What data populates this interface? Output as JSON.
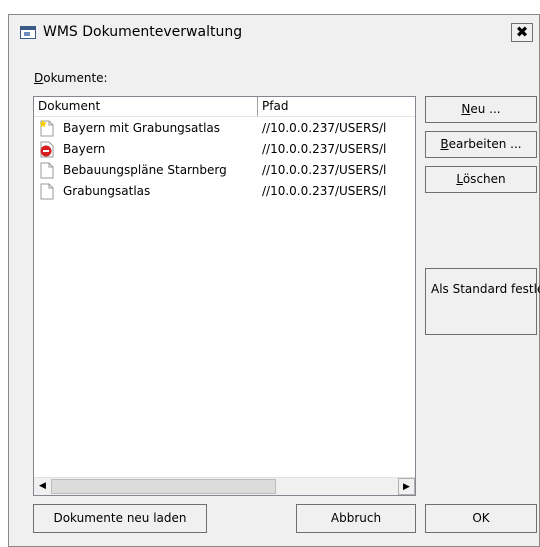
{
  "window": {
    "title": "WMS Dokumenteverwaltung",
    "close_glyph": "✖"
  },
  "documents_label": "Dokumente:",
  "table": {
    "columns": [
      "Dokument",
      "Pfad"
    ],
    "rows": [
      {
        "name": "Bayern mit Grabungsatlas",
        "path": "//10.0.0.237/USERS/l",
        "icon": "default-document-icon"
      },
      {
        "name": "Bayern",
        "path": "//10.0.0.237/USERS/l",
        "icon": "error-document-icon"
      },
      {
        "name": "Bebauungspläne Starnberg",
        "path": "//10.0.0.237/USERS/l",
        "icon": "document-icon"
      },
      {
        "name": "Grabungsatlas",
        "path": "//10.0.0.237/USERS/l",
        "icon": "document-icon"
      }
    ]
  },
  "buttons": {
    "new": "Neu ...",
    "edit": "Bearbeiten ...",
    "delete": "Löschen",
    "set_default": "Als Standard festlegen",
    "reload": "Dokumente neu laden",
    "cancel": "Abbruch",
    "ok": "OK"
  },
  "colors": {
    "window_bg": "#f0f0f0",
    "list_bg": "#ffffff",
    "error_red": "#d42020",
    "star_yellow": "#f5d000"
  }
}
